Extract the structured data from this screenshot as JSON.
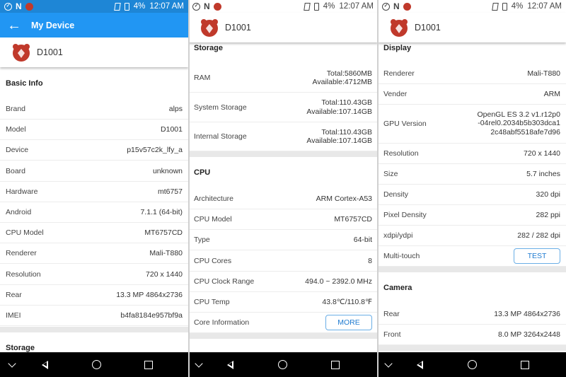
{
  "status": {
    "battery": "4%",
    "time": "12:07 AM",
    "n": "N"
  },
  "screen1": {
    "appbar_title": "My Device",
    "device_name": "D1001",
    "basic_info_title": "Basic Info",
    "rows": [
      {
        "k": "Brand",
        "v": "alps"
      },
      {
        "k": "Model",
        "v": "D1001"
      },
      {
        "k": "Device",
        "v": "p15v57c2k_lfy_a"
      },
      {
        "k": "Board",
        "v": "unknown"
      },
      {
        "k": "Hardware",
        "v": "mt6757"
      },
      {
        "k": "Android",
        "v": "7.1.1 (64-bit)"
      },
      {
        "k": "CPU Model",
        "v": "MT6757CD"
      },
      {
        "k": "Renderer",
        "v": "Mali-T880"
      },
      {
        "k": "Resolution",
        "v": "720 x 1440"
      },
      {
        "k": "Rear",
        "v": "13.3 MP 4864x2736"
      },
      {
        "k": "IMEI",
        "v": "b4fa8184e957bf9a"
      }
    ],
    "storage_title": "Storage"
  },
  "screen2": {
    "device_name": "D1001",
    "storage_title": "Storage",
    "storage_rows": [
      {
        "k": "RAM",
        "v1": "Total:5860MB",
        "v2": "Available:4712MB"
      },
      {
        "k": "System Storage",
        "v1": "Total:110.43GB",
        "v2": "Available:107.14GB"
      },
      {
        "k": "Internal Storage",
        "v1": "Total:110.43GB",
        "v2": "Available:107.14GB"
      }
    ],
    "cpu_title": "CPU",
    "cpu_rows": [
      {
        "k": "Architecture",
        "v": "ARM Cortex-A53"
      },
      {
        "k": "CPU Model",
        "v": "MT6757CD"
      },
      {
        "k": "Type",
        "v": "64-bit"
      },
      {
        "k": "CPU Cores",
        "v": "8"
      },
      {
        "k": "CPU Clock Range",
        "v": "494.0 ~ 2392.0 MHz"
      },
      {
        "k": "CPU Temp",
        "v": "43.8℃/110.8℉"
      }
    ],
    "core_info_label": "Core Information",
    "more_button": "MORE"
  },
  "screen3": {
    "device_name": "D1001",
    "display_title": "Display",
    "display_rows": [
      {
        "k": "Renderer",
        "v": "Mali-T880"
      },
      {
        "k": "Vender",
        "v": "ARM"
      }
    ],
    "gpu_version_label": "GPU Version",
    "gpu_version_lines": [
      "OpenGL ES 3.2 v1.r12p0",
      "-04rel0.2034b5b303dca1",
      "2c48abf5518afe7d96"
    ],
    "display_rows2": [
      {
        "k": "Resolution",
        "v": "720 x 1440"
      },
      {
        "k": "Size",
        "v": "5.7 inches"
      },
      {
        "k": "Density",
        "v": "320 dpi"
      },
      {
        "k": "Pixel Density",
        "v": "282 ppi"
      },
      {
        "k": "xdpi/ydpi",
        "v": "282 / 282 dpi"
      }
    ],
    "multitouch_label": "Multi-touch",
    "test_button": "TEST",
    "camera_title": "Camera",
    "camera_rows": [
      {
        "k": "Rear",
        "v": "13.3 MP 4864x2736"
      },
      {
        "k": "Front",
        "v": "8.0 MP 3264x2448"
      }
    ]
  },
  "colors": {
    "appbar": "#2196f3",
    "statusbar_blue": "#1e86d6",
    "accent": "#1e7ad0",
    "logo": "#c0392b"
  }
}
